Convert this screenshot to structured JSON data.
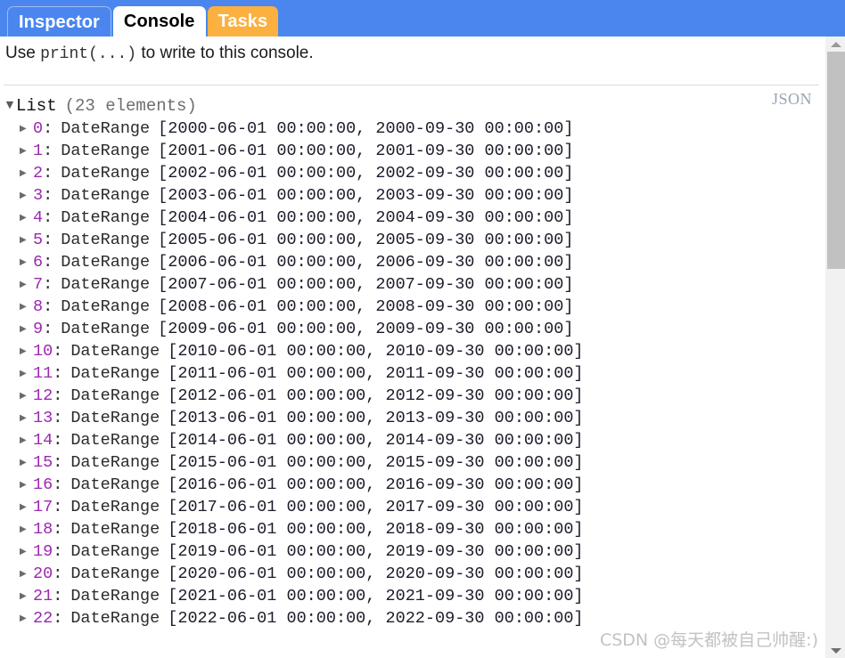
{
  "window": {
    "tabs": [
      {
        "id": "inspector",
        "label": "Inspector",
        "active": false,
        "color": "#4a86ee"
      },
      {
        "id": "console",
        "label": "Console",
        "active": true,
        "color": "#ffffff"
      },
      {
        "id": "tasks",
        "label": "Tasks",
        "active": false,
        "color": "#fbb040"
      }
    ],
    "tabbar_bg": "#4a86ee"
  },
  "console": {
    "hint_prefix": "Use ",
    "hint_code": "print(...)",
    "hint_suffix": " to write to this console.",
    "json_badge": "JSON",
    "root": {
      "twisty": "▼",
      "label": "List",
      "count": "(23 elements)"
    },
    "row_twisty": "▶",
    "rows": [
      {
        "index": "0",
        "colon": ":",
        "type": "DateRange",
        "value": "[2000-06-01 00:00:00, 2000-09-30 00:00:00]"
      },
      {
        "index": "1",
        "colon": ":",
        "type": "DateRange",
        "value": "[2001-06-01 00:00:00, 2001-09-30 00:00:00]"
      },
      {
        "index": "2",
        "colon": ":",
        "type": "DateRange",
        "value": "[2002-06-01 00:00:00, 2002-09-30 00:00:00]"
      },
      {
        "index": "3",
        "colon": ":",
        "type": "DateRange",
        "value": "[2003-06-01 00:00:00, 2003-09-30 00:00:00]"
      },
      {
        "index": "4",
        "colon": ":",
        "type": "DateRange",
        "value": "[2004-06-01 00:00:00, 2004-09-30 00:00:00]"
      },
      {
        "index": "5",
        "colon": ":",
        "type": "DateRange",
        "value": "[2005-06-01 00:00:00, 2005-09-30 00:00:00]"
      },
      {
        "index": "6",
        "colon": ":",
        "type": "DateRange",
        "value": "[2006-06-01 00:00:00, 2006-09-30 00:00:00]"
      },
      {
        "index": "7",
        "colon": ":",
        "type": "DateRange",
        "value": "[2007-06-01 00:00:00, 2007-09-30 00:00:00]"
      },
      {
        "index": "8",
        "colon": ":",
        "type": "DateRange",
        "value": "[2008-06-01 00:00:00, 2008-09-30 00:00:00]"
      },
      {
        "index": "9",
        "colon": ":",
        "type": "DateRange",
        "value": "[2009-06-01 00:00:00, 2009-09-30 00:00:00]"
      },
      {
        "index": "10",
        "colon": ":",
        "type": "DateRange",
        "value": "[2010-06-01 00:00:00, 2010-09-30 00:00:00]"
      },
      {
        "index": "11",
        "colon": ":",
        "type": "DateRange",
        "value": "[2011-06-01 00:00:00, 2011-09-30 00:00:00]"
      },
      {
        "index": "12",
        "colon": ":",
        "type": "DateRange",
        "value": "[2012-06-01 00:00:00, 2012-09-30 00:00:00]"
      },
      {
        "index": "13",
        "colon": ":",
        "type": "DateRange",
        "value": "[2013-06-01 00:00:00, 2013-09-30 00:00:00]"
      },
      {
        "index": "14",
        "colon": ":",
        "type": "DateRange",
        "value": "[2014-06-01 00:00:00, 2014-09-30 00:00:00]"
      },
      {
        "index": "15",
        "colon": ":",
        "type": "DateRange",
        "value": "[2015-06-01 00:00:00, 2015-09-30 00:00:00]"
      },
      {
        "index": "16",
        "colon": ":",
        "type": "DateRange",
        "value": "[2016-06-01 00:00:00, 2016-09-30 00:00:00]"
      },
      {
        "index": "17",
        "colon": ":",
        "type": "DateRange",
        "value": "[2017-06-01 00:00:00, 2017-09-30 00:00:00]"
      },
      {
        "index": "18",
        "colon": ":",
        "type": "DateRange",
        "value": "[2018-06-01 00:00:00, 2018-09-30 00:00:00]"
      },
      {
        "index": "19",
        "colon": ":",
        "type": "DateRange",
        "value": "[2019-06-01 00:00:00, 2019-09-30 00:00:00]"
      },
      {
        "index": "20",
        "colon": ":",
        "type": "DateRange",
        "value": "[2020-06-01 00:00:00, 2020-09-30 00:00:00]"
      },
      {
        "index": "21",
        "colon": ":",
        "type": "DateRange",
        "value": "[2021-06-01 00:00:00, 2021-09-30 00:00:00]"
      },
      {
        "index": "22",
        "colon": ":",
        "type": "DateRange",
        "value": "[2022-06-01 00:00:00, 2022-09-30 00:00:00]"
      }
    ]
  },
  "watermark": "CSDN @每天都被自己帅醒:)",
  "scrollbar": {
    "up_arrow": "▲",
    "down_arrow": "▼"
  },
  "colors": {
    "accent": "#4a86ee",
    "tasks": "#fbb040",
    "index": "#9c27b0",
    "muted": "#6e6e6e"
  }
}
